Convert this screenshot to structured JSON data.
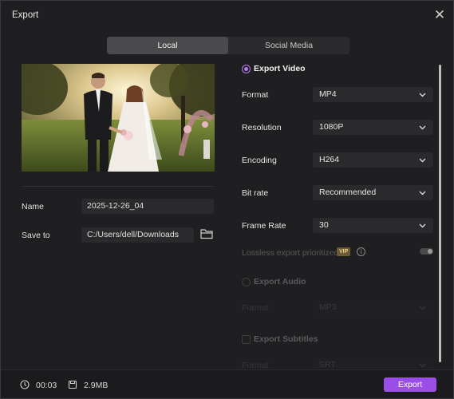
{
  "window": {
    "title": "Export",
    "close_icon": "close-icon"
  },
  "tabs": [
    {
      "label": "Local",
      "selected": true
    },
    {
      "label": "Social Media",
      "selected": false
    }
  ],
  "left": {
    "preview_alt": "wedding-photo-thumbnail",
    "name_label": "Name",
    "name_value": "2025-12-26_04",
    "save_label": "Save to",
    "save_path": "C:/Users/dell/Downloads",
    "folder_icon": "folder-icon"
  },
  "export_video": {
    "title": "Export Video",
    "selected": true,
    "fields": [
      {
        "label": "Format",
        "value": "MP4"
      },
      {
        "label": "Resolution",
        "value": "1080P"
      },
      {
        "label": "Encoding",
        "value": "H264"
      },
      {
        "label": "Bit rate",
        "value": "Recommended"
      },
      {
        "label": "Frame Rate",
        "value": "30"
      }
    ],
    "lossless_label": "Lossless export prioritized",
    "vip_badge": "VIP",
    "lossless_enabled": false
  },
  "export_audio": {
    "title": "Export Audio",
    "selected": false,
    "format_label": "Format",
    "format_value": "MP3"
  },
  "export_subtitles": {
    "title": "Export Subtitles",
    "checked": false,
    "format_label": "Format",
    "format_value": "SRT"
  },
  "footer": {
    "duration": "00:03",
    "size": "2.9MB",
    "export_label": "Export"
  },
  "colors": {
    "accent": "#9b4de8",
    "background": "#1f1f21",
    "field": "#2a2a2c"
  }
}
